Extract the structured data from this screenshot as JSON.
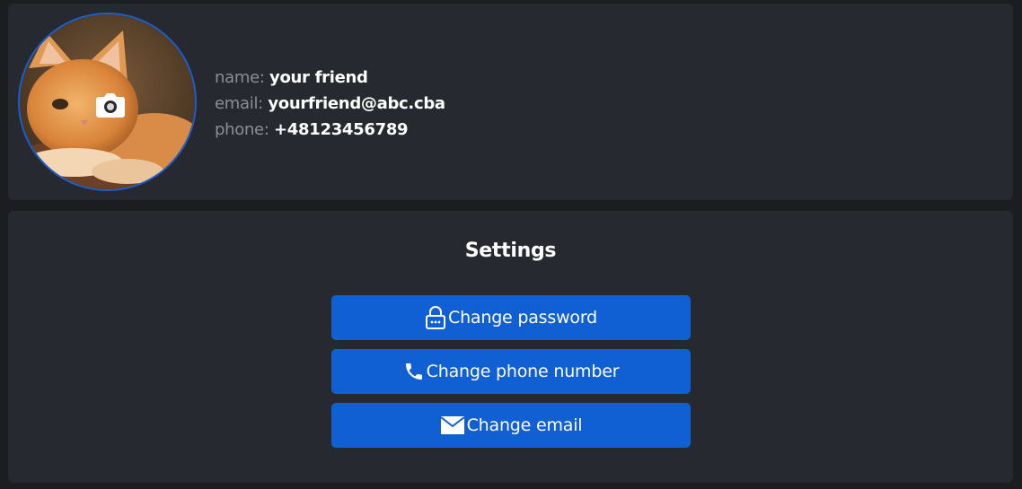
{
  "profile": {
    "name_label": "name:",
    "name_value": "your friend",
    "email_label": "email:",
    "email_value": "yourfriend@abc.cba",
    "phone_label": "phone:",
    "phone_value": "+48123456789",
    "avatar_icon": "camera-icon"
  },
  "settings": {
    "title": "Settings",
    "buttons": [
      {
        "label": "Change password",
        "icon": "lock-icon"
      },
      {
        "label": "Change phone number",
        "icon": "phone-icon"
      },
      {
        "label": "Change email",
        "icon": "mail-icon"
      }
    ]
  },
  "colors": {
    "background": "#1b1d21",
    "panel": "#262930",
    "accent": "#1060d4",
    "avatar_border": "#1a5fd1",
    "label": "#8b8e94",
    "text": "#ffffff"
  }
}
